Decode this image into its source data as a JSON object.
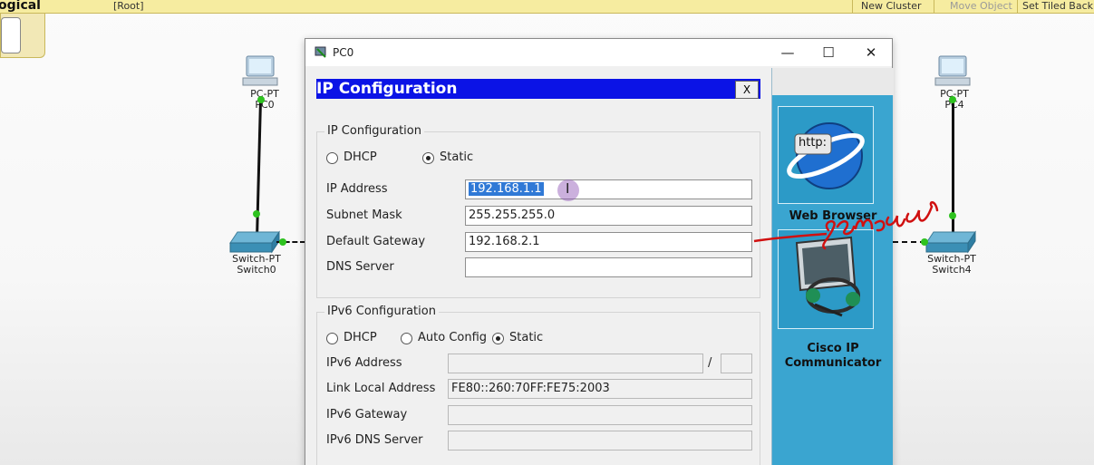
{
  "topbar": {
    "mode_label": "ogical",
    "path_label": "[Root]",
    "new_cluster": "New Cluster",
    "move_object": "Move Object",
    "set_tiled": "Set Tiled Back"
  },
  "devices": {
    "pc0": {
      "type": "PC-PT",
      "name": "PC0"
    },
    "pc4": {
      "type": "PC-PT",
      "name": "PC4"
    },
    "switch0": {
      "type": "Switch-PT",
      "name": "Switch0"
    },
    "switch4": {
      "type": "Switch-PT",
      "name": "Switch4"
    }
  },
  "window": {
    "title": "PC0",
    "minimize": "—",
    "maximize": "☐",
    "close": "✕"
  },
  "ip_config": {
    "header": "IP Configuration",
    "close_label": "X",
    "ipv4": {
      "legend": "IP Configuration",
      "dhcp_label": "DHCP",
      "static_label": "Static",
      "mode": "Static",
      "ip_address_label": "IP Address",
      "ip_address_value": "192.168.1.1",
      "subnet_mask_label": "Subnet Mask",
      "subnet_mask_value": "255.255.255.0",
      "default_gateway_label": "Default Gateway",
      "default_gateway_value": "192.168.2.1",
      "dns_server_label": "DNS Server",
      "dns_server_value": ""
    },
    "ipv6": {
      "legend": "IPv6 Configuration",
      "dhcp_label": "DHCP",
      "auto_config_label": "Auto Config",
      "static_label": "Static",
      "mode": "Static",
      "ipv6_address_label": "IPv6 Address",
      "ipv6_address_value": "",
      "prefix_separator": "/",
      "prefix_value": "",
      "link_local_label": "Link Local Address",
      "link_local_value": "FE80::260:70FF:FE75:2003",
      "ipv6_gateway_label": "IPv6 Gateway",
      "ipv6_gateway_value": "",
      "ipv6_dns_label": "IPv6 DNS Server",
      "ipv6_dns_value": ""
    }
  },
  "desktop_apps": {
    "web_browser": {
      "label": "Web Browser",
      "icon_text": "http:"
    },
    "cisco_ip": {
      "label_line1": "Cisco IP",
      "label_line2": "Communicator"
    }
  },
  "annotation": {
    "handwriting": "Same all"
  },
  "colors": {
    "ip_header": "#0b13e6",
    "desktop_panel": "#3aa5d0",
    "link_dot": "#2ec21f",
    "annotation": "#d01010"
  }
}
